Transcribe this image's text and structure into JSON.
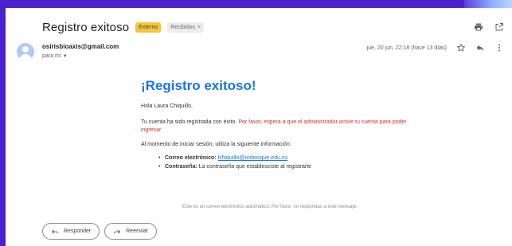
{
  "email": {
    "subject": "Registro exitoso",
    "labels": [
      {
        "text": "Externo",
        "color": "#f4c542"
      },
      {
        "text": "Recibidos",
        "close": "×"
      }
    ],
    "sender": "osirisbioaxis@gmail.com",
    "recipient": "para mí",
    "date": "jue, 20 jun, 22:18 (hace 13 días)"
  },
  "body": {
    "title": "¡Registro exitoso!",
    "greeting": "Hola Laura Chiquillo,",
    "para1_normal": "Tu cuenta ha sido registrada con éxito. ",
    "para1_red": "Por favor, espera a que el administrador active tu cuenta para poder ingresar.",
    "para2": "Al momento de iniciar sesión, utiliza la siguiente información:",
    "items": [
      {
        "label": "Correo electrónico:",
        "value": "lchiquillo@unbosque.edu.co"
      },
      {
        "label": "Contraseña:",
        "value": "La contraseña que establesciste al registrarte"
      }
    ],
    "footer_note": "Este es un correo electrónico automático. Por favor, no respondas a este mensaje."
  },
  "actions": {
    "reply_label": "Responder",
    "forward_label": "Reenviar"
  },
  "icons": {
    "print": "print-icon",
    "open_new": "open-in-new-window-icon",
    "star": "star-icon",
    "reply": "reply-icon",
    "more": "more-vert-icon"
  },
  "colors": {
    "frame": "#4a22c9",
    "title": "#1a73e8",
    "warning": "#d93025",
    "label_externo": "#f4c542"
  }
}
